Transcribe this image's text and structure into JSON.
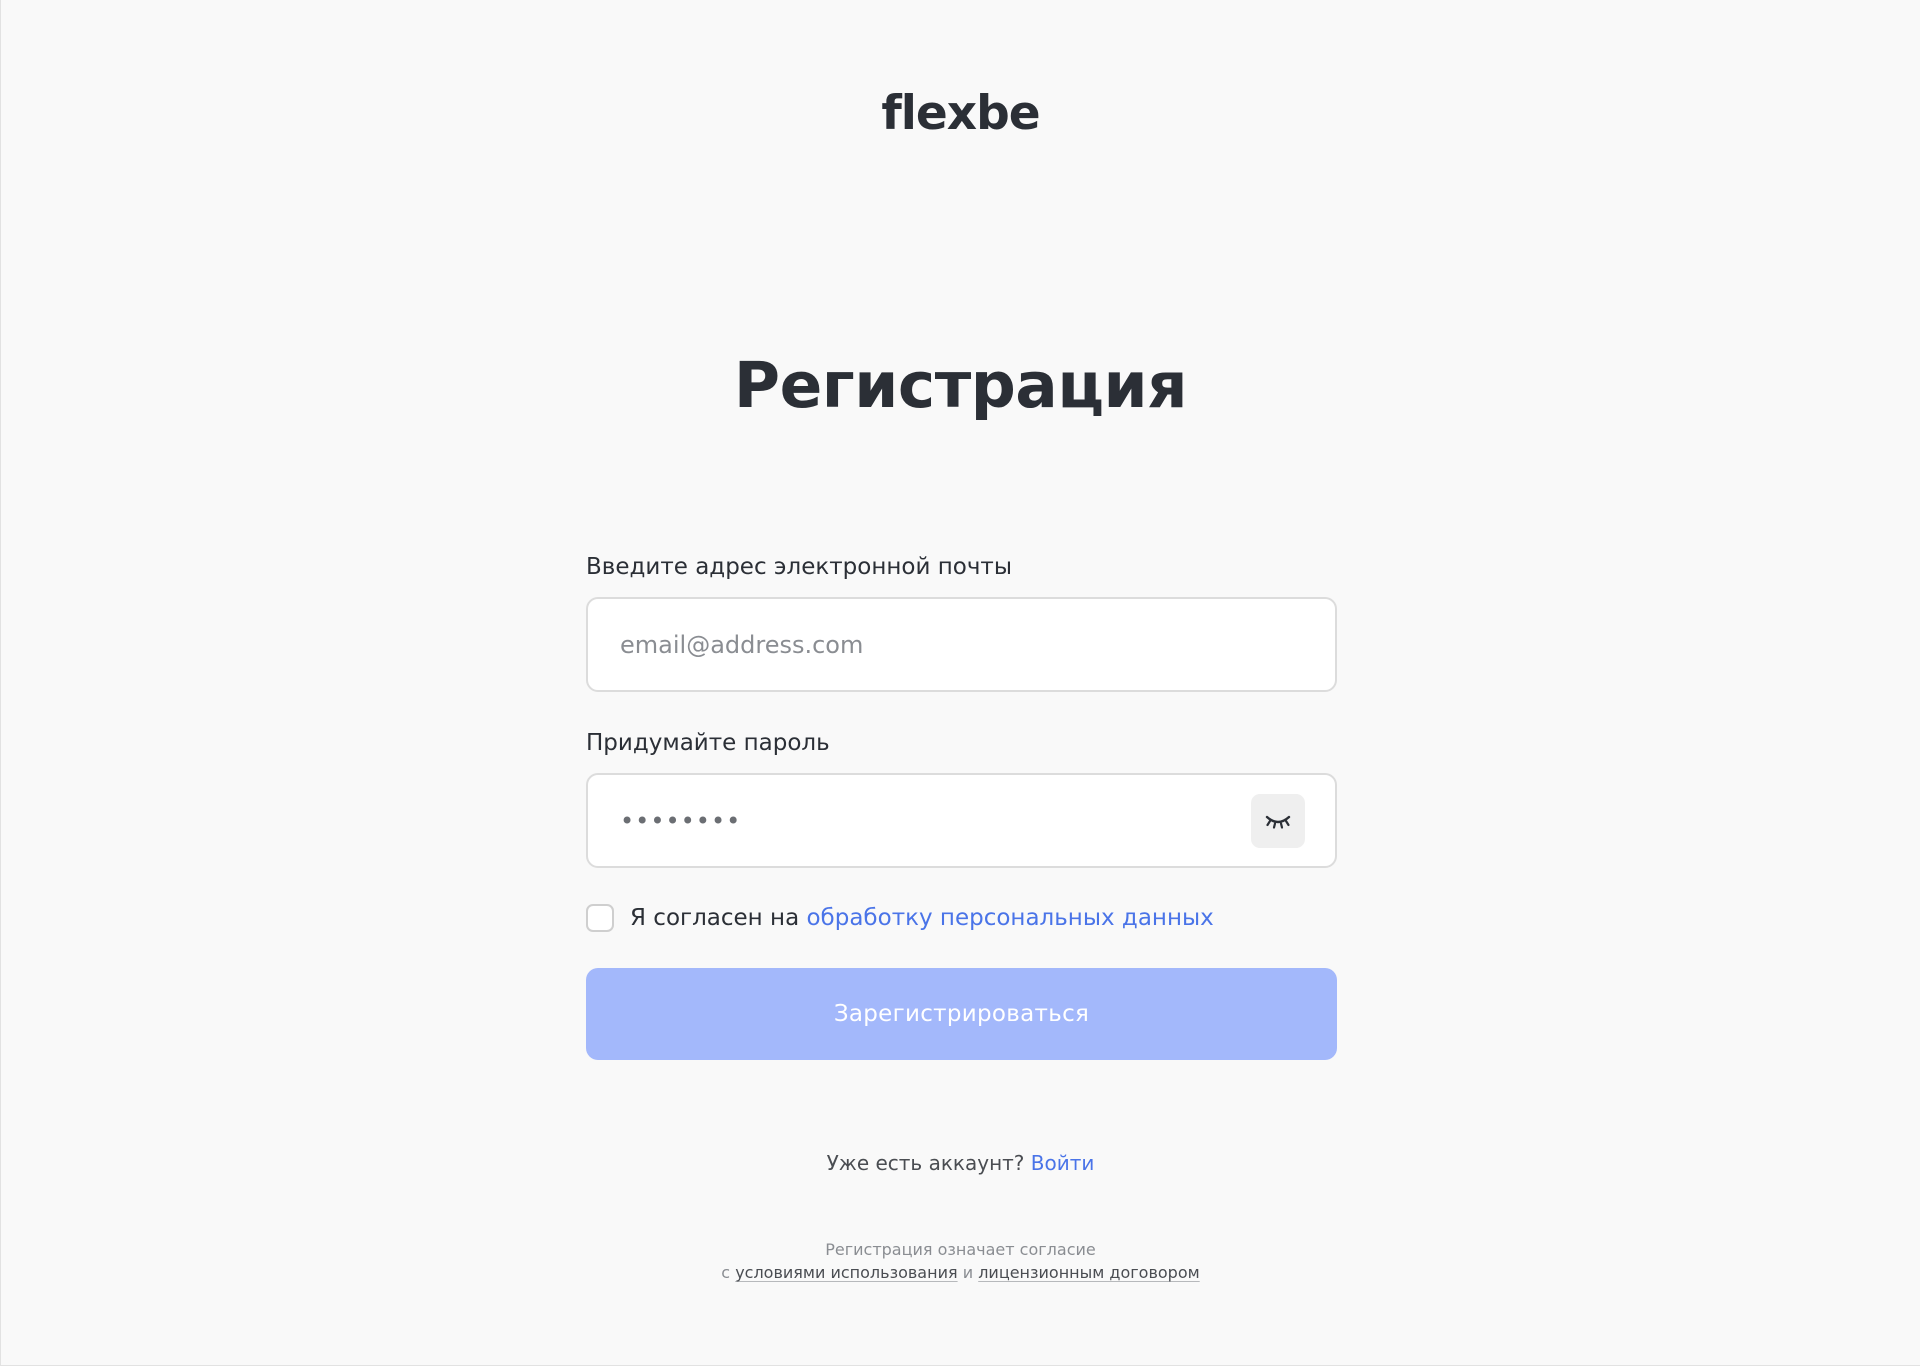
{
  "logo": {
    "text": "flexbe"
  },
  "title": "Регистрация",
  "email": {
    "label": "Введите адрес электронной почты",
    "placeholder": "email@address.com",
    "value": ""
  },
  "password": {
    "label": "Придумайте пароль",
    "masked_value": "••••••••",
    "toggle_icon": "eye-closed-icon"
  },
  "agreement": {
    "prefix": "Я согласен на",
    "link_text": "обработку персональных данных",
    "checked": false
  },
  "submit": {
    "label": "Зарегистрироваться"
  },
  "login": {
    "prompt": "Уже есть аккаунт?",
    "link_text": "Войти"
  },
  "legal": {
    "line1": "Регистрация означает согласие",
    "line2_prefix": "с",
    "terms_link": "условиями использования",
    "and": "и",
    "license_link": "лицензионным договором"
  },
  "colors": {
    "background": "#f9f9f9",
    "accent": "#4a74e8",
    "button_disabled": "#a3b8fb",
    "text": "#2b2f36"
  }
}
